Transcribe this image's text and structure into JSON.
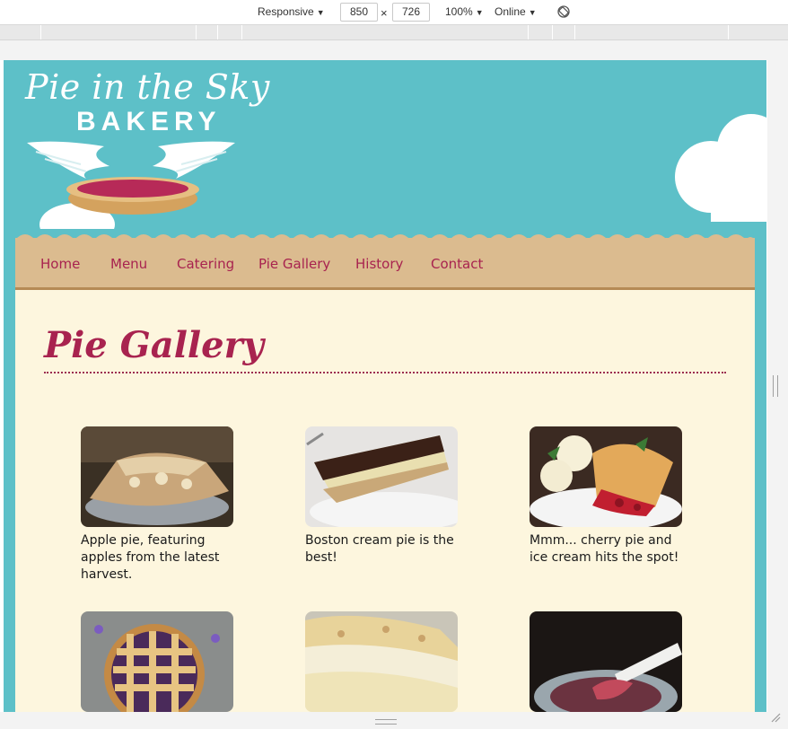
{
  "devtools": {
    "device": "Responsive",
    "width": "850",
    "height": "726",
    "zoom": "100%",
    "network": "Online",
    "times_symbol": "×",
    "dropdown_arrow": "▼"
  },
  "site": {
    "logo_title": "Pie in the Sky",
    "logo_subtitle": "BAKERY",
    "nav": [
      "Home",
      "Menu",
      "Catering",
      "Pie Gallery",
      "History",
      "Contact"
    ],
    "heading": "Pie Gallery",
    "gallery": [
      {
        "caption": "Apple pie, featuring apples from the latest harvest.",
        "icon": "apple-pie-photo"
      },
      {
        "caption": "Boston cream pie is the best!",
        "icon": "boston-cream-pie-photo"
      },
      {
        "caption": "Mmm... cherry pie and ice cream hits the spot!",
        "icon": "cherry-pie-photo"
      },
      {
        "caption": "",
        "icon": "lattice-pie-photo"
      },
      {
        "caption": "",
        "icon": "coconut-cream-pie-photo"
      },
      {
        "caption": "",
        "icon": "berry-pie-photo"
      }
    ]
  },
  "colors": {
    "sky": "#5dc0c8",
    "page": "#fdf6de",
    "nav": "#dbbb8f",
    "accent": "#a8234f"
  }
}
